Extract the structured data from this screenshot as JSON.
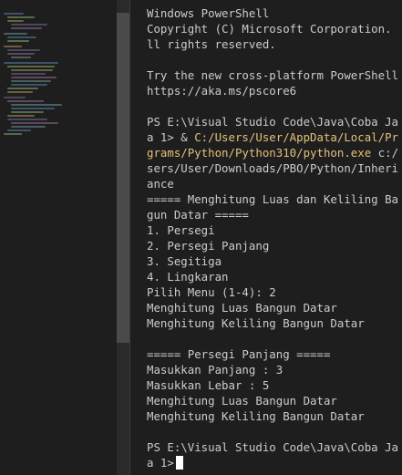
{
  "colors": {
    "background": "#1e1e1e",
    "text": "#cccccc",
    "path_highlight": "#e5c07b",
    "cursor": "#ffffff"
  },
  "terminal": {
    "header_line1": "Windows PowerShell",
    "header_line2": "Copyright (C) Microsoft Corporation. A",
    "header_line3": "ll rights reserved.",
    "try_line1": "Try the new cross-platform PowerShell",
    "try_line2": "https://aka.ms/pscore6",
    "cmd_line1": "PS E:\\Visual Studio Code\\Java\\Coba Jav",
    "cmd_line2_prefix": "a 1> & ",
    "cmd_line2_path": "C:/Users/User/AppData/Local/Pro",
    "cmd_line3_path": "grams/Python/Python310/python.exe",
    "cmd_line3_rest": " c:/U",
    "cmd_line4": "sers/User/Downloads/PBO/Python/Inherit",
    "cmd_line5": "ance",
    "menu_title1": "===== Menghitung Luas dan Keliling Ban",
    "menu_title2": "gun Datar =====",
    "menu_item1": "1. Persegi",
    "menu_item2": "2. Persegi Panjang",
    "menu_item3": "3. Segitiga",
    "menu_item4": "4. Lingkaran",
    "pilih_menu": "Pilih Menu (1-4): 2",
    "out_luas1": "Menghitung Luas Bangun Datar",
    "out_keliling1": "Menghitung Keliling Bangun Datar",
    "section_title": "===== Persegi Panjang =====",
    "input_panjang": "Masukkan Panjang : 3",
    "input_lebar": "Masukkan Lebar : 5",
    "out_luas2": "Menghitung Luas Bangun Datar",
    "out_keliling2": "Menghitung Keliling Bangun Datar",
    "prompt_line1": "PS E:\\Visual Studio Code\\Java\\Coba Jav",
    "prompt_line2": "a 1>"
  }
}
